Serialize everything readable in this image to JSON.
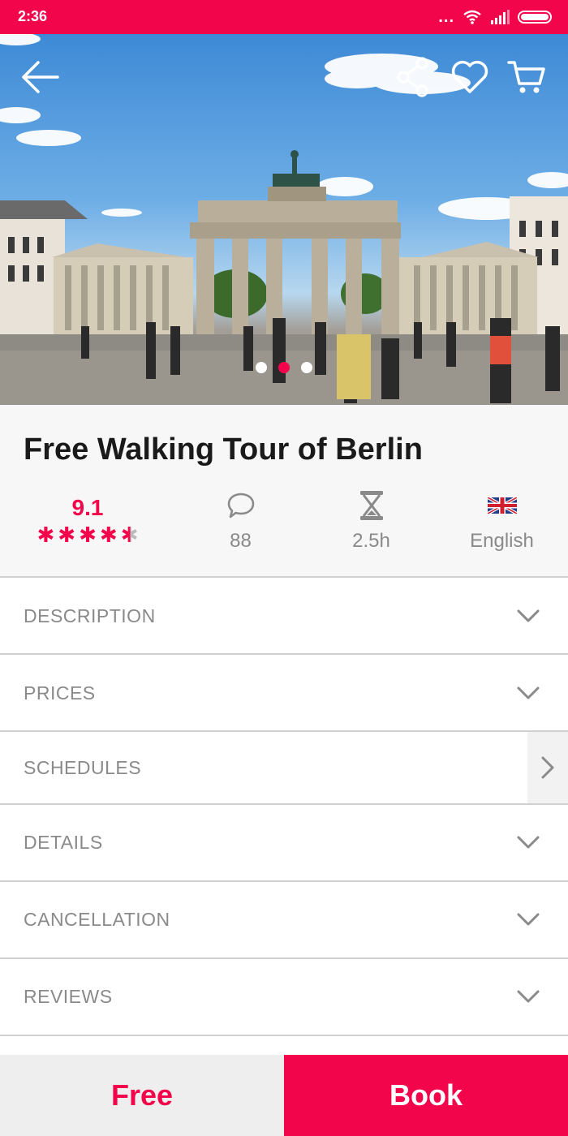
{
  "status_bar": {
    "time": "2:36",
    "dots": "...",
    "colors": {
      "accent": "#f2054b"
    }
  },
  "hero": {
    "icons": [
      "back-arrow-icon",
      "share-icon",
      "heart-icon",
      "cart-icon"
    ],
    "carousel": {
      "count": 3,
      "active_index": 1
    }
  },
  "tour": {
    "title": "Free Walking Tour of Berlin",
    "rating": "9.1",
    "rating_stars": 4.5,
    "reviews_count": "88",
    "duration": "2.5h",
    "language": "English"
  },
  "sections": [
    {
      "label": "DESCRIPTION",
      "chevron": "chevron-down-icon"
    },
    {
      "label": "PRICES",
      "chevron": "chevron-down-icon"
    },
    {
      "label": "SCHEDULES",
      "chevron": "chevron-right-icon"
    },
    {
      "label": "DETAILS",
      "chevron": "chevron-down-icon"
    },
    {
      "label": "CANCELLATION",
      "chevron": "chevron-down-icon"
    },
    {
      "label": "REVIEWS",
      "chevron": "chevron-down-icon"
    }
  ],
  "bottom_bar": {
    "price_label": "Free",
    "book_label": "Book"
  },
  "colors": {
    "brand": "#f2054b",
    "muted_text": "#8a8a8a"
  }
}
